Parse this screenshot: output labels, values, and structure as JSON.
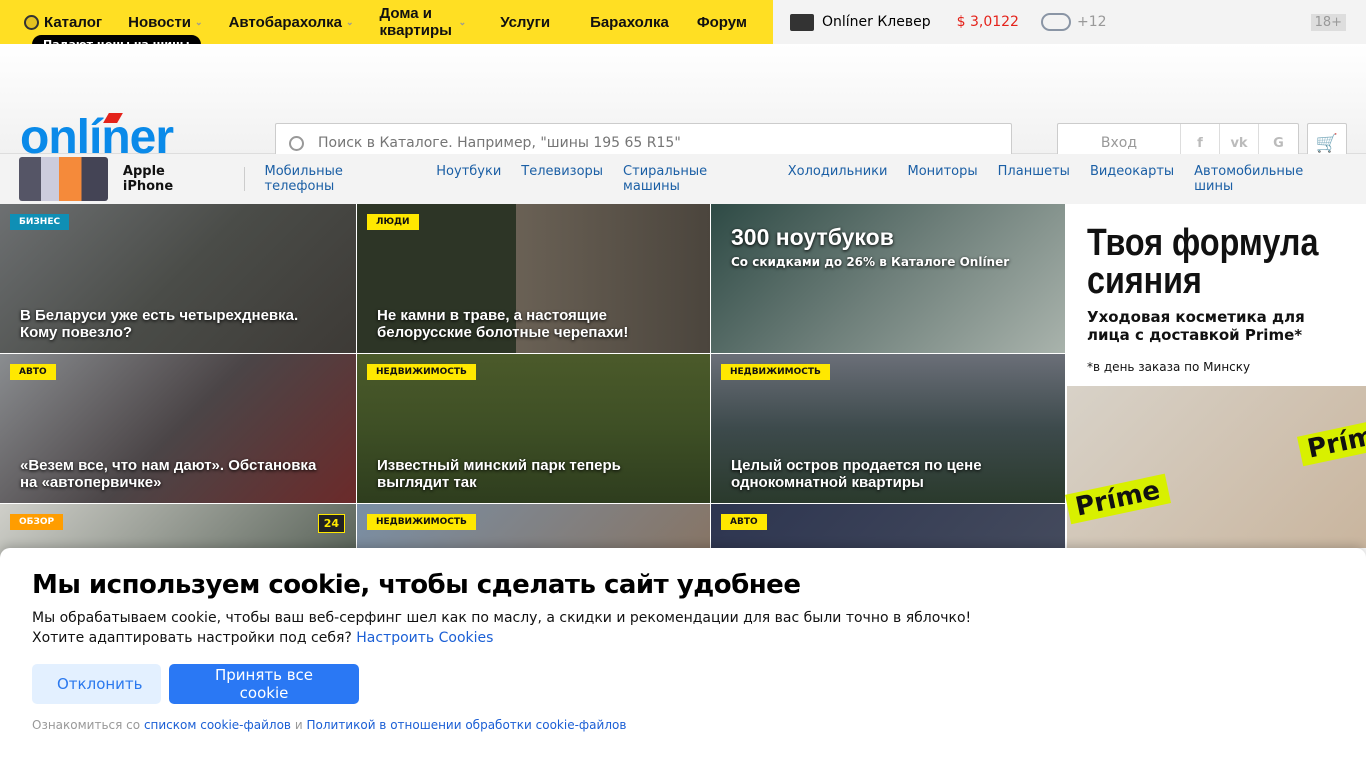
{
  "topnav": {
    "items": [
      {
        "label": "Каталог",
        "chev": false
      },
      {
        "label": "Новости",
        "chev": true
      },
      {
        "label": "Автобарахолка",
        "chev": true
      },
      {
        "label": "Дома и квартиры",
        "chev": true
      },
      {
        "label": "Услуги",
        "chev": false
      },
      {
        "label": "Барахолка",
        "chev": false
      },
      {
        "label": "Форум",
        "chev": false
      }
    ],
    "tooltip": "Падают цены на шины",
    "klever": "Onlíner Клевер",
    "rate": "$ 3,0122",
    "weather": "+12",
    "age": "18+"
  },
  "header": {
    "logo": "onlíner",
    "search_placeholder": "Поиск в Каталоге. Например, \"шины 195 65 R15\"",
    "login": "Вход",
    "social": [
      "f",
      "vk",
      "G"
    ],
    "cart": "🛒"
  },
  "catbar": {
    "promo": "Apple iPhone",
    "links": [
      "Мобильные телефоны",
      "Ноутбуки",
      "Телевизоры",
      "Стиральные машины",
      "Холодильники",
      "Мониторы",
      "Планшеты",
      "Видеокарты",
      "Автомобильные шины"
    ]
  },
  "tiles": [
    {
      "tag": "БИЗНЕС",
      "tag_color": "#0f8fb5",
      "tag_text": "#fff",
      "title": "В Беларуси уже есть четырехдневка. Кому повезло?",
      "bg": "linear-gradient(135deg,#6d7072,#4a4c48,#3d3a36)"
    },
    {
      "tag": "ЛЮДИ",
      "tag_color": "#ffe800",
      "title": "Не камни в траве, а настоящие белорусские болотные черепахи!",
      "bg": "linear-gradient(90deg,#2d3526 0 45%,#6a6155 45%,#4b453d)"
    },
    {
      "tag": "",
      "title": "",
      "bg": "linear-gradient(135deg,#2e4a45,#6e7f7a,#a9b3ac)",
      "promo_title": "300 ноутбуков",
      "promo_sub": "Со скидками до 26% в Каталоге Onlíner"
    },
    {
      "tag": "АВТО",
      "tag_color": "#ffe800",
      "title": "«Везем все, что нам дают». Обстановка на «автопервичке»",
      "bg": "linear-gradient(135deg,#8a8d90,#4b4547,#6b2a2a)"
    },
    {
      "tag": "НЕДВИЖИМОСТЬ",
      "tag_color": "#ffe800",
      "title": "Известный минский парк теперь выглядит так",
      "bg": "linear-gradient(180deg,#4b5a2a,#3e4f25,#2e3d1e)"
    },
    {
      "tag": "НЕДВИЖИМОСТЬ",
      "tag_color": "#ffe800",
      "title": "Целый остров продается по цене однокомнатной квартиры",
      "bg": "linear-gradient(180deg,#6b6f78,#3d4a4c,#2a3a2c)"
    },
    {
      "tag": "ОБЗОР",
      "tag_color": "#ff9d00",
      "tag_text": "#fff",
      "title": "",
      "count": "24",
      "bg": "linear-gradient(135deg,#cfcfc9,#3e4a3f)"
    },
    {
      "tag": "НЕДВИЖИМОСТЬ",
      "tag_color": "#ffe800",
      "title": "",
      "bg": "linear-gradient(135deg,#7a8fa5,#8a6e55)"
    },
    {
      "tag": "АВТО",
      "tag_color": "#ffe800",
      "title": "",
      "bg": "linear-gradient(135deg,#2d3550,#4a5060)"
    }
  ],
  "ad": {
    "title": "Твоя формула сияния",
    "sub": "Уходовая косметика для лица с доставкой Prime*",
    "note": "*в день заказа по Минску",
    "brand": "Príme"
  },
  "cookie": {
    "title": "Мы используем cookie, чтобы сделать сайт удобнее",
    "text1": "Мы обрабатываем cookie, чтобы ваш веб-серфинг шел как по маслу, а скидки и рекомендации для вас были точно в яблочко!",
    "text2": "Хотите адаптировать настройки под себя?",
    "settings_link": "Настроить Cookies",
    "decline": "Отклонить",
    "accept": "Принять все cookie",
    "fine_pre": "Ознакомиться со",
    "fine_link1": "списком cookie-файлов",
    "fine_mid": "и",
    "fine_link2": "Политикой в отношении обработки cookie-файлов"
  }
}
